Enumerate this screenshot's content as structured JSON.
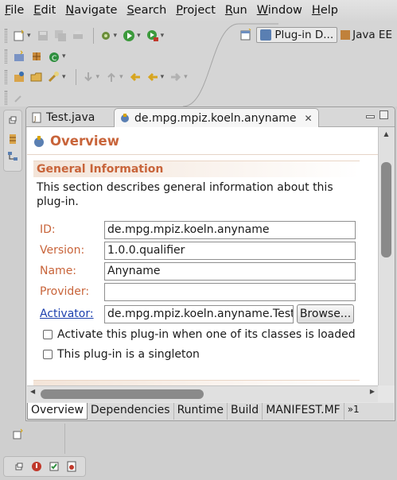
{
  "menu": [
    {
      "label": "File",
      "u": "F",
      "rest": "ile"
    },
    {
      "label": "Edit",
      "u": "E",
      "rest": "dit"
    },
    {
      "label": "Navigate",
      "u": "N",
      "rest": "avigate"
    },
    {
      "label": "Search",
      "u": "S",
      "rest": "earch"
    },
    {
      "label": "Project",
      "u": "P",
      "rest": "roject"
    },
    {
      "label": "Run",
      "u": "R",
      "rest": "un"
    },
    {
      "label": "Window",
      "u": "W",
      "rest": "indow"
    },
    {
      "label": "Help",
      "u": "H",
      "rest": "elp"
    }
  ],
  "perspectives": {
    "active": "Plug-in D...",
    "other": "Java EE"
  },
  "tabs": {
    "inactive": "Test.java",
    "active": "de.mpg.mpiz.koeln.anyname"
  },
  "editor": {
    "title": "Overview",
    "section_title": "General Information",
    "section_desc": "This section describes general information about this plug-in.",
    "fields": {
      "id_label": "ID:",
      "id_value": "de.mpg.mpiz.koeln.anyname",
      "version_label": "Version:",
      "version_value": "1.0.0.qualifier",
      "name_label": "Name:",
      "name_value": "Anyname",
      "provider_label": "Provider:",
      "provider_value": "",
      "activator_label": "Activator:",
      "activator_value": "de.mpg.mpiz.koeln.anyname.Test",
      "browse_label": "Browse..."
    },
    "checkboxes": {
      "activate": "Activate this plug-in when one of its classes is loaded",
      "singleton": "This plug-in is a singleton"
    },
    "page_tabs": [
      "Overview",
      "Dependencies",
      "Runtime",
      "Build",
      "MANIFEST.MF"
    ],
    "more_tabs": "»1"
  },
  "colors": {
    "section_heading": "#c8643a",
    "link": "#1c3fae"
  }
}
